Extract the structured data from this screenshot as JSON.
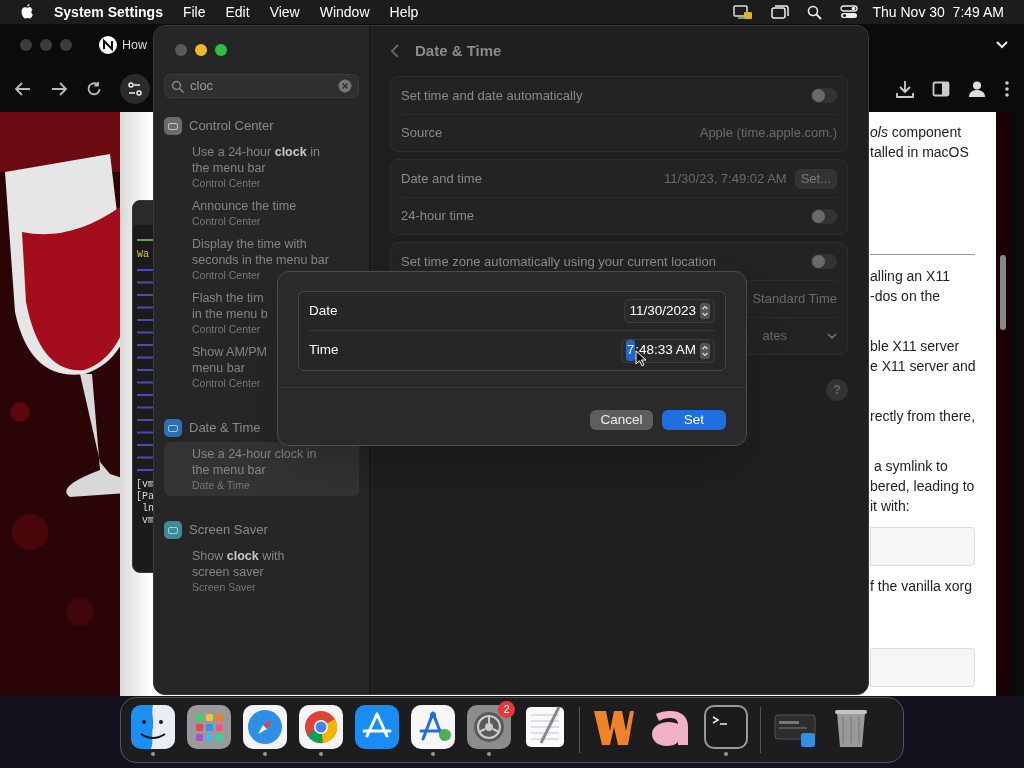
{
  "menu_bar": {
    "app": "System Settings",
    "items": [
      "File",
      "Edit",
      "View",
      "Window",
      "Help"
    ],
    "clock": "Thu Nov 30  7:49 AM"
  },
  "browser": {
    "tab_title": "How",
    "article": [
      {
        "kind": "text",
        "lines": [
          "*ols* component",
          "talled in macOS"
        ]
      },
      {
        "kind": "rule"
      },
      {
        "kind": "text",
        "lines": [
          "alling an X11",
          "-dos on the"
        ]
      },
      {
        "kind": "text",
        "lines": [
          "ble X11 server",
          "e X11 server and"
        ]
      },
      {
        "kind": "text",
        "lines": [
          "rectly from there,"
        ]
      },
      {
        "kind": "text",
        "lines": [
          " a symlink to",
          "bered, leading to",
          "it with:"
        ]
      },
      {
        "kind": "code"
      },
      {
        "kind": "text",
        "lines": [
          "f the vanilla xorg"
        ]
      },
      {
        "kind": "code"
      }
    ]
  },
  "terminal": {
    "lines": [
      "Wa",
      "[vm",
      "[Pa",
      " ln",
      " vm"
    ]
  },
  "settings": {
    "search": "cloc",
    "results": [
      {
        "title": "Control Center",
        "color": "#6b6b6b",
        "items": [
          {
            "lines": [
              "Use a 24-hour **clock** in",
              "the menu bar"
            ],
            "subtitle": "Control Center",
            "selected": false
          },
          {
            "lines": [
              "Announce the time"
            ],
            "subtitle": "Control Center",
            "selected": false
          },
          {
            "lines": [
              "Display the time with",
              "seconds in the menu bar"
            ],
            "subtitle": "Control Center",
            "selected": false
          },
          {
            "lines": [
              "Flash the tim",
              "in the menu b"
            ],
            "subtitle": "Control Center",
            "selected": false
          },
          {
            "lines": [
              "Show AM/PM",
              "menu bar"
            ],
            "subtitle": "Control Center",
            "selected": false
          }
        ]
      },
      {
        "title": "Date & Time",
        "color": "#2f6db5",
        "items": [
          {
            "lines": [
              "Use a 24-hour clock in",
              "the menu bar"
            ],
            "subtitle": "Date & Time",
            "selected": true
          }
        ]
      },
      {
        "title": "Screen Saver",
        "color": "#3b8c96",
        "items": [
          {
            "lines": [
              "Show **clock** with",
              "screen saver"
            ],
            "subtitle": "Screen Saver",
            "selected": false
          }
        ]
      }
    ],
    "title": "Date & Time",
    "groups": [
      {
        "rows": [
          {
            "kind": "toggle",
            "label": "Set time and date automatically",
            "on": false
          },
          {
            "kind": "value",
            "label": "Source",
            "value": "Apple (time.apple.com.)"
          }
        ]
      },
      {
        "rows": [
          {
            "kind": "value_button",
            "label": "Date and time",
            "value": "11/30/23, 7:49:02 AM",
            "button": "Set..."
          },
          {
            "kind": "toggle",
            "label": "24-hour time",
            "on": false
          }
        ]
      },
      {
        "rows": [
          {
            "kind": "toggle",
            "label": "Set time zone automatically using your current location",
            "on": false
          },
          {
            "kind": "value",
            "value": "Standard Time"
          },
          {
            "kind": "dropdown",
            "value": "ates"
          }
        ]
      }
    ],
    "help": "?"
  },
  "dialog": {
    "date": "11/30/2023",
    "date_label": "Date",
    "time_label": "Time",
    "time_segments": [
      {
        "text": "7",
        "selected": true
      },
      {
        "text": ":48:33 AM",
        "selected": false
      }
    ],
    "buttons": [
      {
        "label": "Cancel",
        "kind": "secondary"
      },
      {
        "label": "Set",
        "kind": "primary"
      }
    ]
  },
  "dock": [
    {
      "kind": "finder",
      "running": true
    },
    {
      "kind": "launchpad",
      "running": false
    },
    {
      "kind": "safari",
      "running": true
    },
    {
      "kind": "chrome",
      "running": true
    },
    {
      "kind": "appstore",
      "running": false
    },
    {
      "kind": "instruments",
      "running": true
    },
    {
      "kind": "settings",
      "running": true,
      "badge": "2"
    },
    {
      "kind": "textedit",
      "running": false
    },
    {
      "kind": "divider"
    },
    {
      "kind": "wine_w",
      "running": false
    },
    {
      "kind": "wine_a",
      "running": false
    },
    {
      "kind": "terminal",
      "running": true
    },
    {
      "kind": "divider"
    },
    {
      "kind": "window_thumb",
      "running": false
    },
    {
      "kind": "trash",
      "running": false
    }
  ]
}
